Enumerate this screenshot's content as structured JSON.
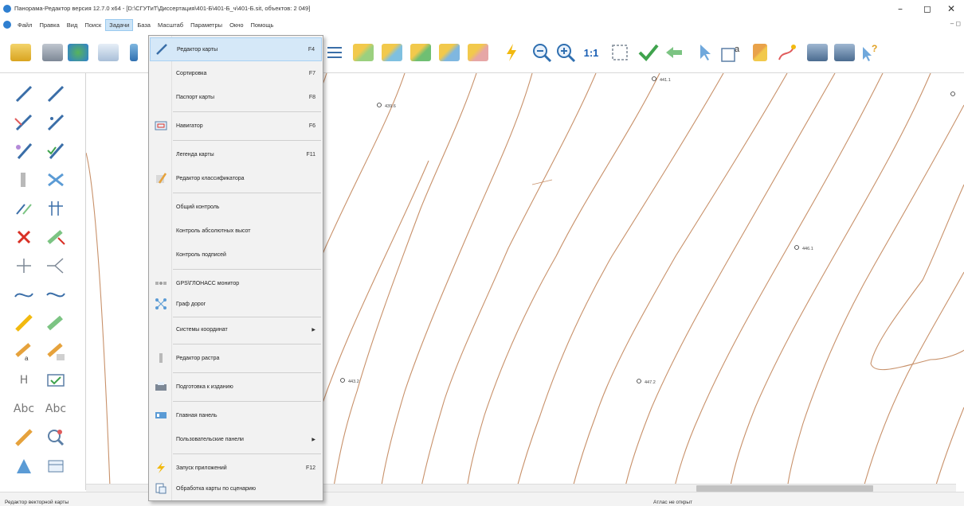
{
  "window": {
    "title": "Панорама-Редактор версия 12.7.0 x64 - [D:\\СГУТиТ\\Диссертация\\401-Б\\401-Б_ч\\401-Б.sit, объектов: 2 049]",
    "minimize_label": "–",
    "maximize_label": "◻",
    "close_label": "✕"
  },
  "menubar": {
    "items": [
      "Файл",
      "Правка",
      "Вид",
      "Поиск",
      "Задачи",
      "База",
      "Масштаб",
      "Параметры",
      "Окно",
      "Помощь"
    ],
    "active_index": 4,
    "mdi_controls": "‒ ◻"
  },
  "toolbar": {
    "scale_label": "1:1",
    "buttons": [
      "open-icon",
      "save-icon",
      "globe-icon",
      "database-icon",
      "pencil-icon",
      "list-icon",
      "tag-icon",
      "tag-edit-icon",
      "tag-add-icon",
      "tag-move-icon",
      "tag-delete-icon",
      "lightning-icon",
      "zoom-out-icon",
      "zoom-in-icon",
      "scale-1-1-icon",
      "fit-window-icon",
      "check-icon",
      "back-arrow-icon",
      "cursor-icon",
      "text-label-icon",
      "brush-icon",
      "route-icon",
      "printer-icon",
      "printer-2-icon",
      "help-cursor-icon"
    ]
  },
  "left_panel": {
    "text_tools": [
      "H",
      "Abc",
      "Abc"
    ]
  },
  "map": {
    "spot_heights": [
      "439.6",
      "441.1",
      "446.1",
      "443.2",
      "447.2"
    ],
    "contour_color": "#c8916a"
  },
  "dropdown": {
    "title": "Задачи",
    "items": [
      {
        "label": "Редактор карты",
        "shortcut": "F4",
        "icon": "pencil-icon",
        "highlight": true
      },
      {
        "label": "Сортировка",
        "shortcut": "F7",
        "icon": "",
        "highlight": false
      },
      {
        "label": "Паспорт карты",
        "shortcut": "F8",
        "icon": "",
        "highlight": false
      },
      {
        "label": "Навигатор",
        "shortcut": "F6",
        "icon": "navigator-icon",
        "highlight": false
      },
      {
        "label": "Легенда карты",
        "shortcut": "F11",
        "icon": "",
        "highlight": false
      },
      {
        "label": "Редактор классификатора",
        "shortcut": "",
        "icon": "classifier-icon",
        "highlight": false
      },
      {
        "label": "Общий контроль",
        "shortcut": "",
        "icon": "",
        "highlight": false
      },
      {
        "label": "Контроль абсолютных высот",
        "shortcut": "",
        "icon": "",
        "highlight": false
      },
      {
        "label": "Контроль подписей",
        "shortcut": "",
        "icon": "",
        "highlight": false
      },
      {
        "label": "GPS\\ГЛОНАСС монитор",
        "shortcut": "",
        "icon": "satellite-icon",
        "highlight": false
      },
      {
        "label": "Граф дорог",
        "shortcut": "",
        "icon": "road-graph-icon",
        "highlight": false
      },
      {
        "label": "Системы координат",
        "shortcut": "",
        "icon": "",
        "highlight": false,
        "submenu": true
      },
      {
        "label": "Редактор растра",
        "shortcut": "",
        "icon": "raster-icon",
        "highlight": false
      },
      {
        "label": "Подготовка к изданию",
        "shortcut": "",
        "icon": "print-prep-icon",
        "highlight": false
      },
      {
        "label": "Главная панель",
        "shortcut": "",
        "icon": "main-panel-icon",
        "highlight": false
      },
      {
        "label": "Пользовательские панели",
        "shortcut": "",
        "icon": "",
        "highlight": false,
        "submenu": true
      },
      {
        "label": "Запуск приложений",
        "shortcut": "F12",
        "icon": "lightning-icon",
        "highlight": false
      },
      {
        "label": "Обработка карты по сценарию",
        "shortcut": "",
        "icon": "script-icon",
        "highlight": false
      }
    ]
  },
  "statusbar": {
    "left": "Редактор векторной карты",
    "right": "Атлас не открыт"
  },
  "colors": {
    "menu_highlight": "#cce4f7",
    "dropdown_bg": "#f2f2f2",
    "contour": "#c8916a"
  }
}
